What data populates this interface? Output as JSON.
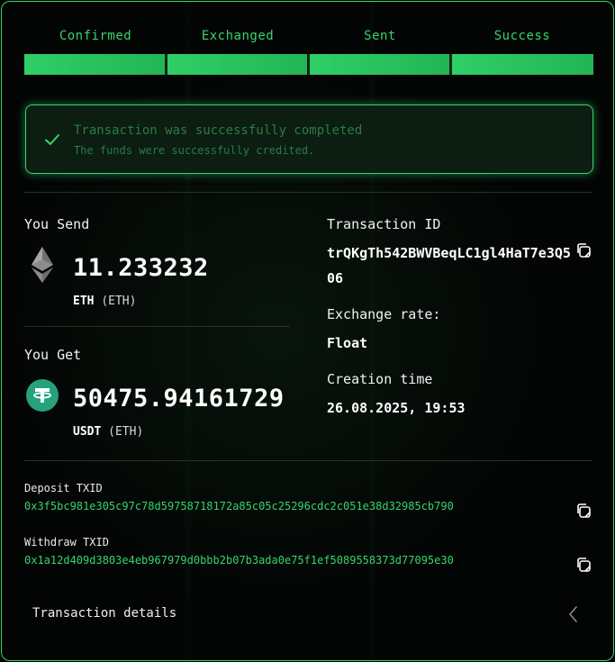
{
  "steps": [
    "Confirmed",
    "Exchanged",
    "Sent",
    "Success"
  ],
  "status": {
    "title": "Transaction was successfully completed",
    "subtitle": "The funds were successfully credited."
  },
  "send": {
    "label": "You Send",
    "amount": "11.233232",
    "ticker": "ETH",
    "network": "(ETH)",
    "icon": "ethereum-icon"
  },
  "get": {
    "label": "You Get",
    "amount": "50475.94161729",
    "ticker": "USDT",
    "network": "(ETH)",
    "icon": "tether-icon"
  },
  "transaction": {
    "id_label": "Transaction ID",
    "id_line1": "trQKgTh542BWVBeqLC1gl4HaT7e3Q5",
    "id_line2": "06",
    "rate_label": "Exchange rate:",
    "rate_value": "Float",
    "time_label": "Creation time",
    "time_value": "26.08.2025, 19:53"
  },
  "deposit": {
    "label": "Deposit TXID",
    "hash": "0x3f5bc981e305c97c78d59758718172a85c05c25296cdc2c051e38d32985cb790"
  },
  "withdraw": {
    "label": "Withdraw TXID",
    "hash": "0x1a12d409d3803e4eb967979d0bbb2b07b3ada0e75f1ef5089558373d77095e30"
  },
  "details_label": "Transaction details",
  "colors": {
    "accent": "#35d56e",
    "background": "#030504",
    "usdt": "#26a17b"
  }
}
